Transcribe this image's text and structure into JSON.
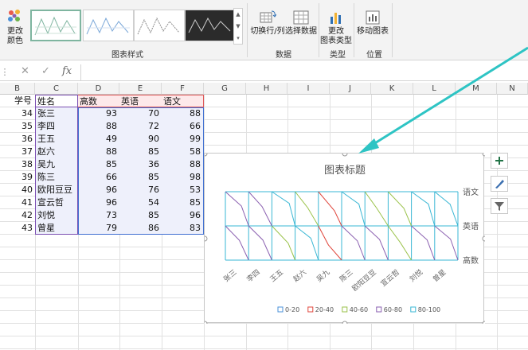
{
  "ribbon": {
    "change_color_label_1": "更改",
    "change_color_label_2": "颜色",
    "chart_styles_group": "图表样式",
    "switch_row_col": "切换行/列",
    "select_data": "选择数据",
    "data_group": "数据",
    "change_chart_type_1": "更改",
    "change_chart_type_2": "图表类型",
    "type_group": "类型",
    "move_chart": "移动图表",
    "location_group": "位置"
  },
  "formula_bar": {
    "fx": "fx",
    "cancel": "✕",
    "confirm": "✓"
  },
  "columns": [
    "B",
    "C",
    "D",
    "E",
    "F",
    "G",
    "H",
    "I",
    "J",
    "K",
    "L",
    "M",
    "N"
  ],
  "table": {
    "headers": {
      "id": "学号",
      "name": "姓名",
      "math": "高数",
      "english": "英语",
      "chinese": "语文"
    },
    "rows": [
      {
        "id": "34",
        "name": "张三",
        "math": "93",
        "english": "70",
        "chinese": "88"
      },
      {
        "id": "35",
        "name": "李四",
        "math": "88",
        "english": "72",
        "chinese": "66"
      },
      {
        "id": "36",
        "name": "王五",
        "math": "49",
        "english": "90",
        "chinese": "99"
      },
      {
        "id": "37",
        "name": "赵六",
        "math": "88",
        "english": "85",
        "chinese": "58"
      },
      {
        "id": "38",
        "name": "吴九",
        "math": "85",
        "english": "36",
        "chinese": "88"
      },
      {
        "id": "39",
        "name": "陈三",
        "math": "66",
        "english": "85",
        "chinese": "98"
      },
      {
        "id": "40",
        "name": "欧阳豆豆",
        "math": "96",
        "english": "76",
        "chinese": "53"
      },
      {
        "id": "41",
        "name": "宣云哲",
        "math": "96",
        "english": "54",
        "chinese": "85"
      },
      {
        "id": "42",
        "name": "刘悦",
        "math": "73",
        "english": "85",
        "chinese": "96"
      },
      {
        "id": "43",
        "name": "曾星",
        "math": "79",
        "english": "86",
        "chinese": "83"
      }
    ]
  },
  "chart_data": {
    "type": "surface-wireframe",
    "title": "图表标题",
    "categories": [
      "张三",
      "李四",
      "王五",
      "赵六",
      "吴九",
      "陈三",
      "欧阳豆豆",
      "宣云哲",
      "刘悦",
      "曾星"
    ],
    "series": [
      {
        "name": "高数",
        "values": [
          93,
          88,
          49,
          88,
          85,
          66,
          96,
          96,
          73,
          79
        ]
      },
      {
        "name": "英语",
        "values": [
          70,
          72,
          90,
          85,
          36,
          85,
          76,
          54,
          85,
          86
        ]
      },
      {
        "name": "语文",
        "values": [
          88,
          66,
          99,
          58,
          88,
          98,
          53,
          85,
          96,
          83
        ]
      }
    ],
    "legend": [
      {
        "label": "0-20",
        "color": "#4a90d9"
      },
      {
        "label": "20-40",
        "color": "#e0463c"
      },
      {
        "label": "40-60",
        "color": "#9ac24a"
      },
      {
        "label": "60-80",
        "color": "#8a5fb0"
      },
      {
        "label": "80-100",
        "color": "#3ab7d4"
      }
    ],
    "legend_position": "bottom"
  },
  "colors": {
    "accent_green": "#217346",
    "arrow": "#2ec4c4",
    "chinese_header_bg": "#fde9ea",
    "math_header_bg": "#fde9ea",
    "selection_purple": "#7b4fb2",
    "selection_blue": "#3f6fd1"
  }
}
